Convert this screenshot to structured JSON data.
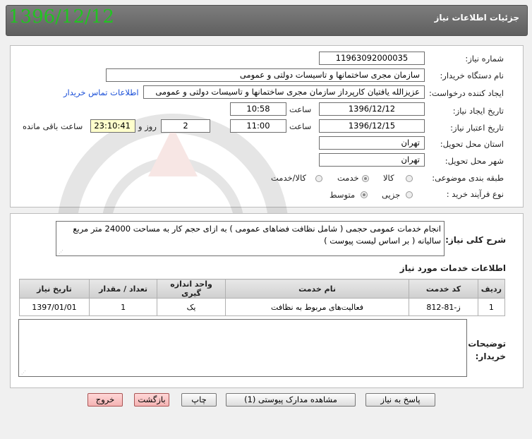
{
  "header": {
    "title": "جزئیات اطلاعات نیاز",
    "date": "1396/12/12"
  },
  "form": {
    "need_number": {
      "label": "شماره نیاز:",
      "value": "1196309200003​5"
    },
    "buyer_org": {
      "label": "نام دستگاه خریدار:",
      "value": "سازمان مجری ساختمانها و تاسیسات دولتی و عمومی"
    },
    "requester": {
      "label": "ایجاد کننده درخواست:",
      "value": "عزیزالله  یافتیان کارپرداز سازمان مجری ساختمانها و تاسیسات دولتی و عمومی",
      "contact_link": "اطلاعات تماس خریدار"
    },
    "created": {
      "label": "تاریخ ایجاد نیاز:",
      "date": "1396/12/12",
      "time_label": "ساعت",
      "time": "10:58"
    },
    "validity": {
      "label": "تاریخ اعتبار نیاز:",
      "date": "1396/12/15",
      "time_label": "ساعت",
      "time": "11:00",
      "days": "2",
      "days_label": "روز و",
      "remaining": "23:10:41",
      "remaining_label": "ساعت باقی مانده"
    },
    "province": {
      "label": "استان محل تحویل:",
      "value": "تهران"
    },
    "city": {
      "label": "شهر محل تحویل:",
      "value": "تهران"
    },
    "category": {
      "label": "طبقه بندی موضوعی:",
      "options": [
        "کالا",
        "خدمت",
        "کالا/خدمت"
      ],
      "selected": "خدمت"
    },
    "process": {
      "label": "نوع فرآیند خرید :",
      "options": [
        "جزیی",
        "متوسط"
      ],
      "selected": "متوسط"
    }
  },
  "description": {
    "label": "شرح کلی نیاز:",
    "text": "انجام خدمات عمومی حجمی ( شامل نظافت فضاهای عمومی ) به ازای حجم کار به مساحت 24000 متر مربع سالیانه ( بر اساس لیست پیوست )"
  },
  "services": {
    "title": "اطلاعات خدمات مورد نیاز",
    "columns": [
      "ردیف",
      "کد خدمت",
      "نام خدمت",
      "واحد اندازه گیری",
      "تعداد / مقدار",
      "تاریخ نیاز"
    ],
    "rows": [
      [
        "1",
        "ز-81-812",
        "فعالیت‌های مربوط به نظافت",
        "یک",
        "1",
        "1397/01/01"
      ]
    ]
  },
  "buyer_notes": {
    "label": "توضیحات خریدار:",
    "value": ""
  },
  "buttons": {
    "reply": "پاسخ به نیاز",
    "attachments": "مشاهده مدارک پیوستی (1)",
    "print": "چاپ",
    "back": "بازگشت",
    "exit": "خروج"
  },
  "colors": {
    "header_bg": "#6e6e6e",
    "date_green": "#22c322",
    "remaining_bg": "#ffffcc",
    "exit_bg": "#f4b3b3",
    "link": "#1a4fd8"
  }
}
